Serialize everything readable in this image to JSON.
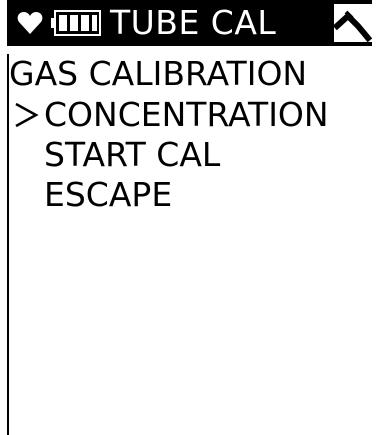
{
  "header": {
    "title": "TUBE CAL",
    "icons": [
      "heart-icon",
      "battery-icon",
      "signal-icon"
    ]
  },
  "subtitle": "GAS CALIBRATION",
  "menu": {
    "selected_index": 0,
    "items": [
      {
        "label": "CONCENTRATION"
      },
      {
        "label": "START CAL"
      },
      {
        "label": "ESCAPE"
      }
    ]
  },
  "colors": {
    "background": "#ffffff",
    "foreground": "#000000",
    "header_background": "#000000",
    "header_text": "#ffffff"
  }
}
